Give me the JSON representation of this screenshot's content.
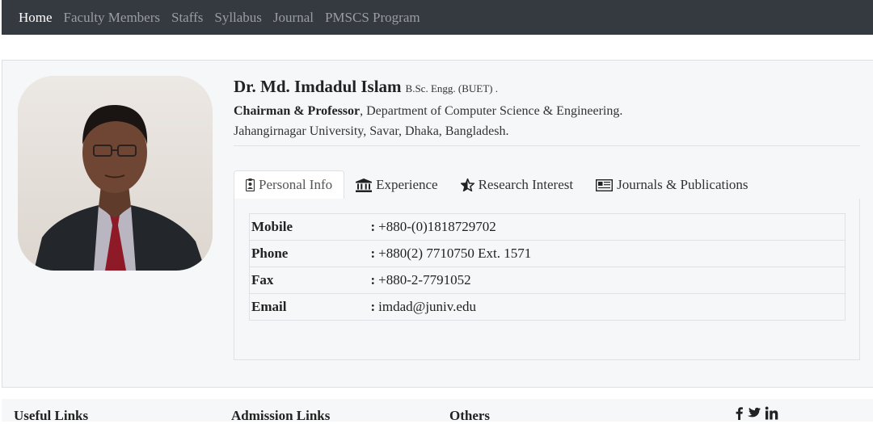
{
  "nav": {
    "items": [
      {
        "label": "Home",
        "active": true
      },
      {
        "label": "Faculty Members",
        "active": false
      },
      {
        "label": "Staffs",
        "active": false
      },
      {
        "label": "Syllabus",
        "active": false
      },
      {
        "label": "Journal",
        "active": false
      },
      {
        "label": "PMSCS Program",
        "active": false
      }
    ]
  },
  "profile": {
    "name": "Dr. Md. Imdadul Islam",
    "degree": "B.Sc. Engg. (BUET) .",
    "position": "Chairman & Professor",
    "department": ", Department of Computer Science & Engineering.",
    "address": "Jahangirnagar University, Savar, Dhaka, Bangladesh.",
    "photo_icon": "person-photo"
  },
  "tabs": [
    {
      "label": "Personal Info",
      "icon": "id-badge-icon",
      "active": true
    },
    {
      "label": "Experience",
      "icon": "institution-icon",
      "active": false
    },
    {
      "label": "Research Interest",
      "icon": "star-icon",
      "active": false
    },
    {
      "label": "Journals & Publications",
      "icon": "newspaper-icon",
      "active": false
    }
  ],
  "personal_info": {
    "separator": ":",
    "rows": [
      {
        "label": "Mobile",
        "value": "+880-(0)1818729702"
      },
      {
        "label": "Phone",
        "value": "+880(2) 7710750 Ext. 1571"
      },
      {
        "label": "Fax",
        "value": "+880-2-7791052"
      },
      {
        "label": "Email",
        "value": "imdad@juniv.edu"
      }
    ]
  },
  "footer": {
    "useful_links": "Useful Links",
    "admission_links": "Admission Links",
    "others": "Others",
    "social_icons": [
      "facebook-icon",
      "twitter-icon",
      "linkedin-icon"
    ]
  },
  "colors": {
    "navbar": "#343a40",
    "nav_active": "#ffffff",
    "nav_inactive": "#9a9da1",
    "card_bg": "#f6f7f9"
  }
}
